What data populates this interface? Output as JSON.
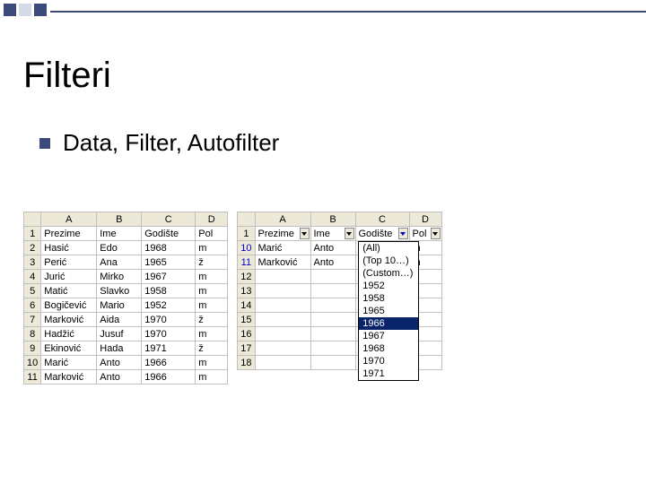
{
  "title": "Filteri",
  "bullet": "Data, Filter, Autofilter",
  "columns": [
    "A",
    "B",
    "C",
    "D"
  ],
  "headers": {
    "A": "Prezime",
    "B": "Ime",
    "C": "Godište",
    "D": "Pol"
  },
  "left": {
    "rownums": [
      "1",
      "2",
      "3",
      "4",
      "5",
      "6",
      "7",
      "8",
      "9",
      "10",
      "11"
    ],
    "rows": [
      [
        "Prezime",
        "Ime",
        "Godište",
        "Pol"
      ],
      [
        "Hasić",
        "Edo",
        "1968",
        "m"
      ],
      [
        "Perić",
        "Ana",
        "1965",
        "ž"
      ],
      [
        "Jurić",
        "Mirko",
        "1967",
        "m"
      ],
      [
        "Matić",
        "Slavko",
        "1958",
        "m"
      ],
      [
        "Bogičević",
        "Mario",
        "1952",
        "m"
      ],
      [
        "Marković",
        "Aida",
        "1970",
        "ž"
      ],
      [
        "Hadžić",
        "Jusuf",
        "1970",
        "m"
      ],
      [
        "Ekinović",
        "Hada",
        "1971",
        "ž"
      ],
      [
        "Marić",
        "Anto",
        "1966",
        "m"
      ],
      [
        "Marković",
        "Anto",
        "1966",
        "m"
      ]
    ]
  },
  "right": {
    "rownums": [
      "1",
      "10",
      "11",
      "12",
      "13",
      "14",
      "15",
      "16",
      "17",
      "18"
    ],
    "rows": [
      [
        "Prezime",
        "Ime",
        "Godište",
        "Pol"
      ],
      [
        "Marić",
        "Anto",
        "",
        "m"
      ],
      [
        "Marković",
        "Anto",
        "",
        "m"
      ],
      [
        "",
        "",
        "",
        ""
      ],
      [
        "",
        "",
        "",
        ""
      ],
      [
        "",
        "",
        "",
        ""
      ],
      [
        "",
        "",
        "",
        ""
      ],
      [
        "",
        "",
        "",
        ""
      ],
      [
        "",
        "",
        "",
        ""
      ],
      [
        "",
        "",
        "",
        ""
      ]
    ],
    "blue_rows": [
      "10",
      "11"
    ]
  },
  "dropdown": {
    "items": [
      "(All)",
      "(Top 10…)",
      "(Custom…)",
      "1952",
      "1958",
      "1965",
      "1966",
      "1967",
      "1968",
      "1970",
      "1971"
    ],
    "selected": "1966"
  }
}
